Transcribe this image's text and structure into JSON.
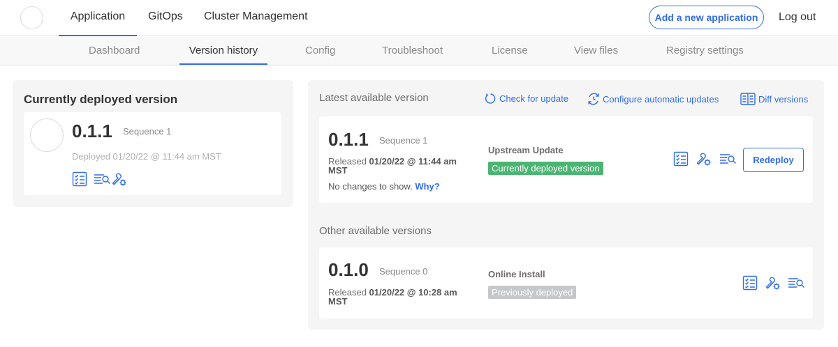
{
  "header": {
    "nav": [
      "Application",
      "GitOps",
      "Cluster Management"
    ],
    "add_button": "Add a new application",
    "logout": "Log out"
  },
  "subnav": {
    "tabs": [
      "Dashboard",
      "Version history",
      "Config",
      "Troubleshoot",
      "License",
      "View files",
      "Registry settings"
    ],
    "active": "Version history"
  },
  "current": {
    "title": "Currently deployed version",
    "version": "0.1.1",
    "sequence": "Sequence 1",
    "deployed": "Deployed 01/20/22 @ 11:44 am MST",
    "icons": [
      "checklist-icon",
      "logs-search-icon",
      "wrench-gear-icon"
    ]
  },
  "latest": {
    "label": "Latest available version",
    "actions": {
      "check": "Check for update",
      "configure": "Configure automatic updates",
      "diff": "Diff versions"
    },
    "version": "0.1.1",
    "sequence": "Sequence 1",
    "released_prefix": "Released ",
    "released_date": "01/20/22 @ 11:44 am",
    "released_tz": "MST",
    "source": "Upstream Update",
    "badge": "Currently deployed version",
    "no_changes": "No changes to show.",
    "why": "Why?",
    "redeploy": "Redeploy"
  },
  "other": {
    "label": "Other available versions",
    "version": "0.1.0",
    "sequence": "Sequence 0",
    "released_prefix": "Released ",
    "released_date": "01/20/22 @ 10:28 am",
    "released_tz": "MST",
    "source": "Online Install",
    "badge": "Previously deployed"
  },
  "colors": {
    "accent": "#326de6",
    "deployed_badge": "#4ab472",
    "previous_badge": "#c4c8ca"
  }
}
